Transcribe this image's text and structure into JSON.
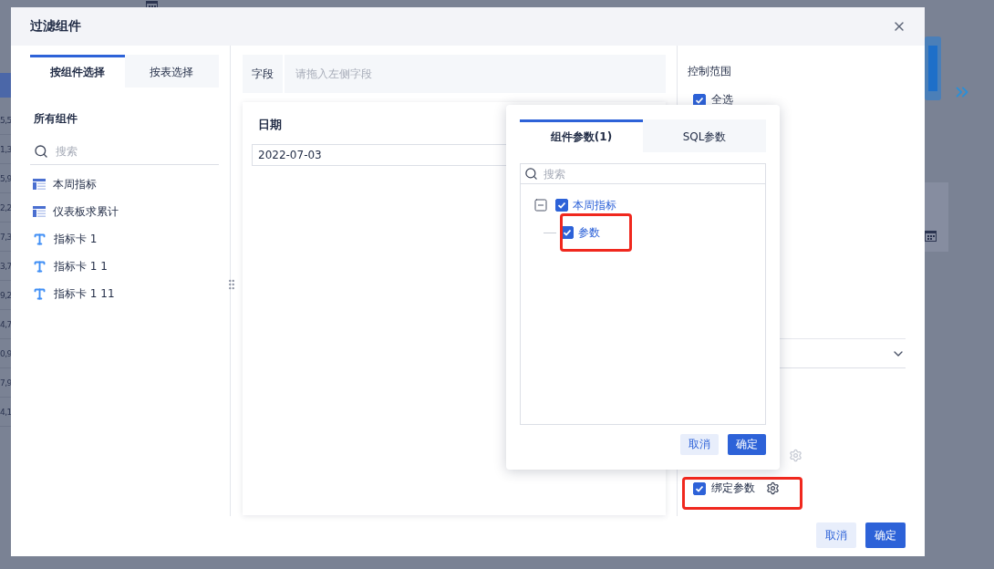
{
  "background_cells": [
    "5,5",
    "1,3",
    "5,9",
    "2,2",
    "7,3",
    "3,7",
    "9,2",
    "4,7",
    "0,9",
    "7,9",
    "4,1"
  ],
  "dialog": {
    "title": "过滤组件"
  },
  "left_tabs": [
    {
      "label": "按组件选择",
      "selected": true
    },
    {
      "label": "按表选择",
      "selected": false
    }
  ],
  "components": {
    "heading": "所有组件",
    "search_placeholder": "搜索",
    "items": [
      {
        "label": "本周指标",
        "kind": "table"
      },
      {
        "label": "仪表板求累计",
        "kind": "table"
      },
      {
        "label": "指标卡 1",
        "kind": "text"
      },
      {
        "label": "指标卡 1 1",
        "kind": "text"
      },
      {
        "label": "指标卡 1 11",
        "kind": "text"
      }
    ]
  },
  "field": {
    "label": "字段",
    "placeholder": "请拖入左侧字段"
  },
  "preview": {
    "title": "日期",
    "value": "2022-07-03"
  },
  "control_range": {
    "heading": "控制范围",
    "select_all": {
      "label": "全选",
      "checked": true
    }
  },
  "bind_param": {
    "label": "绑定参数",
    "checked": true
  },
  "footer_buttons": [
    {
      "label": "取消",
      "kind": "secondary"
    },
    {
      "label": "确定",
      "kind": "primary"
    }
  ],
  "popup": {
    "tabs": [
      {
        "label": "组件参数(1)",
        "selected": true
      },
      {
        "label": "SQL参数",
        "selected": false
      }
    ],
    "search_placeholder": "搜索",
    "tree": [
      {
        "label": "本周指标",
        "checked": true,
        "expanded": true,
        "children": [
          {
            "label": "参数",
            "checked": true
          }
        ]
      }
    ],
    "buttons": [
      {
        "label": "取消",
        "kind": "secondary"
      },
      {
        "label": "确定",
        "kind": "primary"
      }
    ]
  }
}
